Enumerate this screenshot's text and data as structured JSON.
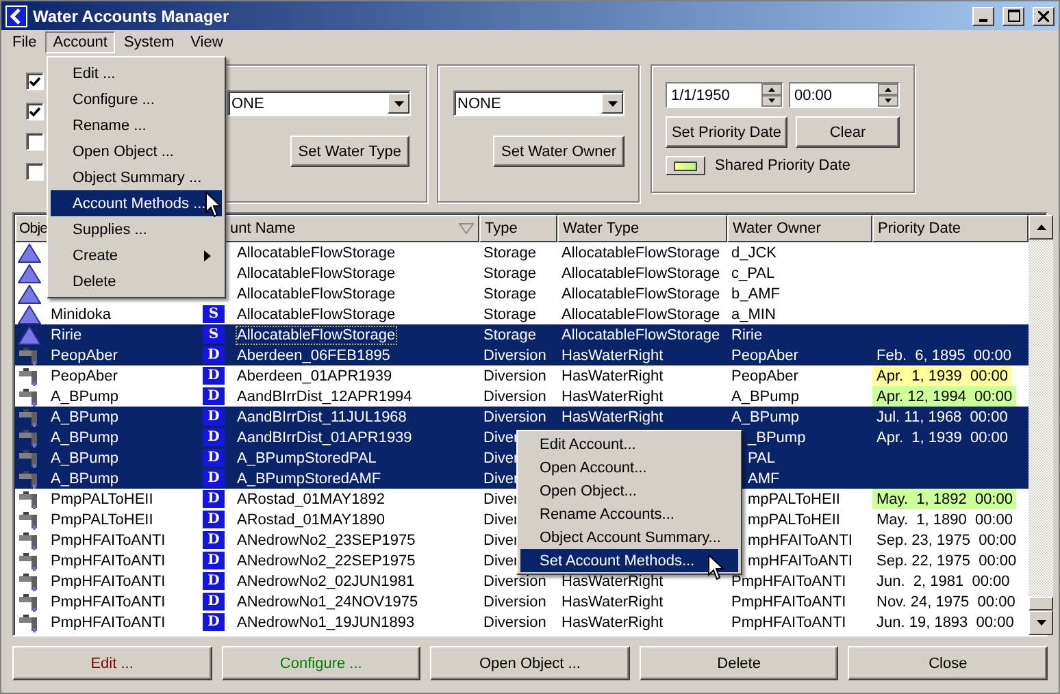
{
  "window": {
    "title": "Water Accounts Manager"
  },
  "menu_bar": [
    {
      "label": "File",
      "open": false
    },
    {
      "label": "Account",
      "open": true
    },
    {
      "label": "System",
      "open": false
    },
    {
      "label": "View",
      "open": false
    }
  ],
  "account_menu": [
    {
      "label": "Edit ...",
      "selected": false,
      "kind": "item"
    },
    {
      "label": "Configure ...",
      "selected": false,
      "kind": "item"
    },
    {
      "label": "Rename ...",
      "selected": false,
      "kind": "item"
    },
    {
      "label": "Open Object ...",
      "selected": false,
      "kind": "item"
    },
    {
      "label": "Object Summary ...",
      "selected": false,
      "kind": "item"
    },
    {
      "label": "Account Methods ...",
      "selected": true,
      "kind": "item"
    },
    {
      "label": "Supplies ...",
      "selected": false,
      "kind": "item"
    },
    {
      "label": "Create",
      "selected": false,
      "kind": "submenu"
    },
    {
      "label": "Delete",
      "selected": false,
      "kind": "item"
    }
  ],
  "filters": [
    {
      "checked": true
    },
    {
      "checked": true
    },
    {
      "checked": false
    },
    {
      "checked": false
    }
  ],
  "water_type": {
    "value": "ONE",
    "button": "Set Water Type"
  },
  "water_owner": {
    "value": "NONE",
    "button": "Set Water Owner"
  },
  "priority": {
    "date": "1/1/1950",
    "time": "00:00",
    "set_button": "Set Priority Date",
    "clear_button": "Clear",
    "shared_label": "Shared Priority Date"
  },
  "table": {
    "columns": [
      {
        "label": "Obje",
        "clipped": false
      },
      {
        "label": "unt Name",
        "clipped": true,
        "sorted": true
      },
      {
        "label": "Type",
        "clipped": false,
        "sorted": false
      },
      {
        "label": "Water Type",
        "clipped": false,
        "sorted": false
      },
      {
        "label": "Water Owner",
        "clipped": false,
        "sorted": false
      },
      {
        "label": "Priority Date",
        "clipped": false,
        "sorted": false
      }
    ],
    "rows": [
      {
        "kind": "storage",
        "account": "AllocatableFlowStorage",
        "type": "Storage",
        "water_type": "AllocatableFlowStorage",
        "owner": "d_JCK",
        "selected": false,
        "focused": false
      },
      {
        "kind": "storage",
        "account": "AllocatableFlowStorage",
        "type": "Storage",
        "water_type": "AllocatableFlowStorage",
        "owner": "c_PAL",
        "selected": false,
        "focused": false
      },
      {
        "kind": "storage",
        "account": "AllocatableFlowStorage",
        "type": "Storage",
        "water_type": "AllocatableFlowStorage",
        "owner": "b_AMF",
        "selected": false,
        "focused": false
      },
      {
        "kind": "storage",
        "object": "Minidoka",
        "badge": "S",
        "account": "AllocatableFlowStorage",
        "type": "Storage",
        "water_type": "AllocatableFlowStorage",
        "owner": "a_MIN",
        "selected": false,
        "focused": false
      },
      {
        "kind": "storage",
        "object": "Ririe",
        "badge": "S",
        "account": "AllocatableFlowStorage",
        "type": "Storage",
        "water_type": "AllocatableFlowStorage",
        "owner": "Ririe",
        "selected": true,
        "focused": true
      },
      {
        "kind": "diversion",
        "object": "PeopAber",
        "badge": "D",
        "account": "Aberdeen_06FEB1895",
        "type": "Diversion",
        "water_type": "HasWaterRight",
        "owner": "PeopAber",
        "priority_date": "Feb.  6, 1895  00:00",
        "selected": true,
        "focused": false
      },
      {
        "kind": "diversion",
        "object": "PeopAber",
        "badge": "D",
        "account": "Aberdeen_01APR1939",
        "type": "Diversion",
        "water_type": "HasWaterRight",
        "owner": "PeopAber",
        "priority_date": "Apr.  1, 1939  00:00",
        "color": "#ffffa0",
        "selected": false,
        "focused": false
      },
      {
        "kind": "diversion",
        "object": "A_BPump",
        "badge": "D",
        "account": "AandBIrrDist_12APR1994",
        "type": "Diversion",
        "water_type": "HasWaterRight",
        "owner": "A_BPump",
        "priority_date": "Apr. 12, 1994  00:00",
        "color": "#ccff99",
        "selected": false,
        "focused": false
      },
      {
        "kind": "diversion",
        "object": "A_BPump",
        "badge": "D",
        "account": "AandBIrrDist_11JUL1968",
        "type": "Diversion",
        "water_type": "HasWaterRight",
        "owner": "A_BPump",
        "priority_date": "Jul. 11, 1968  00:00",
        "selected": true,
        "focused": false
      },
      {
        "kind": "diversion",
        "object": "A_BPump",
        "badge": "D",
        "account": "AandBIrrDist_01APR1939",
        "type": "Diver",
        "owner": "_BPump",
        "owner_clipped": true,
        "priority_date": "Apr.  1, 1939  00:00",
        "selected": true,
        "focused": false
      },
      {
        "kind": "diversion",
        "object": "A_BPump",
        "badge": "D",
        "account": "A_BPumpStoredPAL",
        "type": "Diver",
        "owner": "PAL",
        "owner_clipped": true,
        "selected": true,
        "focused": false
      },
      {
        "kind": "diversion",
        "object": "A_BPump",
        "badge": "D",
        "account": "A_BPumpStoredAMF",
        "type": "Diver",
        "owner": "AMF",
        "owner_clipped": true,
        "selected": true,
        "focused": false
      },
      {
        "kind": "diversion",
        "object": "PmpPALToHEII",
        "badge": "D",
        "account": "ARostad_01MAY1892",
        "type": "Diver",
        "owner": "mpPALToHEII",
        "owner_clipped": true,
        "priority_date": "May.  1, 1892  00:00",
        "color": "#ccff99",
        "selected": false,
        "focused": false
      },
      {
        "kind": "diversion",
        "object": "PmpPALToHEII",
        "badge": "D",
        "account": "ARostad_01MAY1890",
        "type": "Diver",
        "owner": "mpPALToHEII",
        "owner_clipped": true,
        "priority_date": "May.  1, 1890  00:00",
        "selected": false,
        "focused": false
      },
      {
        "kind": "diversion",
        "object": "PmpHFAIToANTI",
        "badge": "D",
        "account": "ANedrowNo2_23SEP1975",
        "type": "Diver",
        "owner": "mpHFAIToANTI",
        "owner_clipped": true,
        "priority_date": "Sep. 23, 1975  00:00",
        "selected": false,
        "focused": false
      },
      {
        "kind": "diversion",
        "object": "PmpHFAIToANTI",
        "badge": "D",
        "account": "ANedrowNo2_22SEP1975",
        "type": "Diver",
        "owner": "mpHFAIToANTI",
        "owner_clipped": true,
        "priority_date": "Sep. 22, 1975  00:00",
        "selected": false,
        "focused": false
      },
      {
        "kind": "diversion",
        "object": "PmpHFAIToANTI",
        "badge": "D",
        "account": "ANedrowNo2_02JUN1981",
        "type": "Diversion",
        "water_type": "HasWaterRight",
        "owner": "PmpHFAIToANTI",
        "priority_date": "Jun.  2, 1981  00:00",
        "selected": false,
        "focused": false
      },
      {
        "kind": "diversion",
        "object": "PmpHFAIToANTI",
        "badge": "D",
        "account": "ANedrowNo1_24NOV1975",
        "type": "Diversion",
        "water_type": "HasWaterRight",
        "owner": "PmpHFAIToANTI",
        "priority_date": "Nov. 24, 1975  00:00",
        "selected": false,
        "focused": false
      },
      {
        "kind": "diversion",
        "object": "PmpHFAIToANTI",
        "badge": "D",
        "account": "ANedrowNo1_19JUN1893",
        "type": "Diversion",
        "water_type": "HasWaterRight",
        "owner": "PmpHFAIToANTI",
        "priority_date": "Jun. 19, 1893  00:00",
        "selected": false,
        "focused": false
      }
    ]
  },
  "context_menu": [
    {
      "label": "Edit Account...",
      "selected": false
    },
    {
      "label": "Open Account...",
      "selected": false
    },
    {
      "label": "Open Object...",
      "selected": false
    },
    {
      "label": "Rename Accounts...",
      "selected": false
    },
    {
      "label": "Object Account Summary...",
      "selected": false
    },
    {
      "label": "Set Account Methods...",
      "selected": true
    }
  ],
  "buttons": [
    {
      "label": "Edit ...",
      "color": "#800000"
    },
    {
      "label": "Configure ...",
      "color": "#008000"
    },
    {
      "label": "Open Object ...",
      "color": "#000000"
    },
    {
      "label": "Delete",
      "color": "#000000"
    },
    {
      "label": "Close",
      "color": "#000000"
    }
  ]
}
